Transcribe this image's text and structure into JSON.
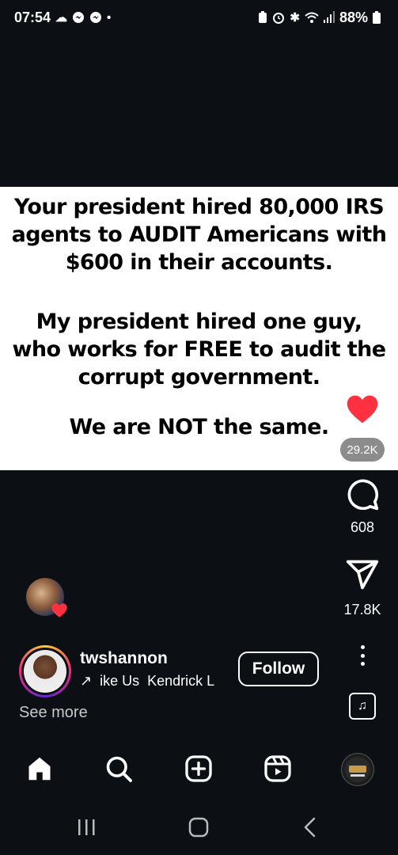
{
  "status_bar": {
    "time": "07:54",
    "left_icons": [
      "cloud-icon",
      "messenger-icon",
      "messenger-icon",
      "dot-icon"
    ],
    "right_icons": [
      "battery-saver-icon",
      "alarm-icon",
      "bluetooth-icon",
      "wifi-icon",
      "signal-icon"
    ],
    "battery": "88%"
  },
  "post": {
    "lines_block1": [
      "Your president hired 80,000 IRS",
      "agents to AUDIT Americans with",
      "$600 in their accounts."
    ],
    "lines_block2": [
      "My president hired one guy,",
      "who works for FREE to audit the",
      "corrupt government."
    ],
    "last_line": "We are NOT the same."
  },
  "actions": {
    "likes": "29.2K",
    "comments": "608",
    "shares": "17.8K",
    "like_color": "#ff3040"
  },
  "author": {
    "username": "twshannon",
    "audio_arrow": "↗",
    "audio_title": "ike Us",
    "audio_artist": "Kendrick L",
    "follow_label": "Follow",
    "see_more": "See more"
  },
  "nav": [
    "home-icon",
    "search-icon",
    "create-icon",
    "reels-icon",
    "profile-icon"
  ]
}
